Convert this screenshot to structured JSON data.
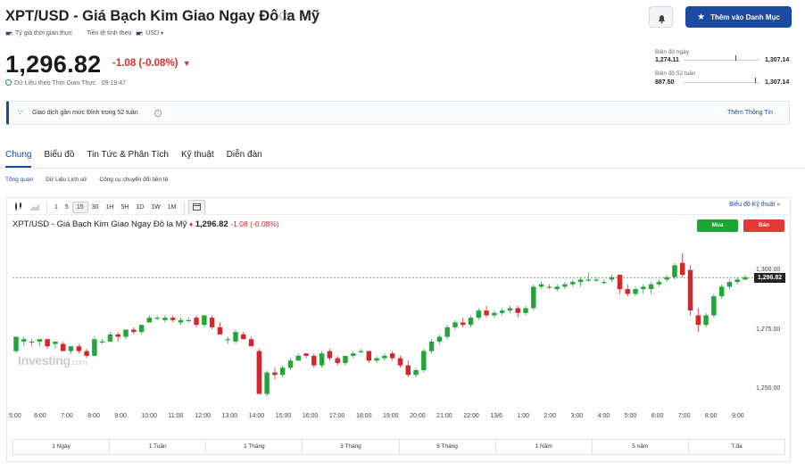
{
  "header": {
    "title": "XPT/USD - Giá Bạch Kim Giao Ngay Đô la Mỹ",
    "sub_rate_label": "Tỷ giá thời gian thực",
    "sub_currency_label": "Tiền tệ tính theo",
    "sub_currency_value": "USD",
    "watchlist_label": "Thêm vào Danh Mục"
  },
  "quote": {
    "price": "1,296.82",
    "change": "-1.08 (-0.08%)",
    "realtime": "Dữ Liệu theo Thời Gian Thực · 09:19:47"
  },
  "ranges": {
    "day_label": "Biên độ ngày",
    "day_low": "1,274.11",
    "day_high": "1,307.14",
    "week52_label": "Biên độ 52 tuần",
    "week52_low": "887.50",
    "week52_high": "1,307.14"
  },
  "banner": {
    "text": "Giao dịch gần mức Đỉnh trong 52 tuần",
    "link": "Thêm Thông Tin"
  },
  "tabs": [
    "Chung",
    "Biểu đồ",
    "Tin Tức & Phân Tích",
    "Kỹ thuật",
    "Diễn đàn"
  ],
  "subtabs": [
    "Tổng quan",
    "Dữ Liệu Lịch sử",
    "Công cụ chuyển đổi tiền tệ"
  ],
  "toolbar": {
    "intervals": [
      "1",
      "5",
      "15",
      "30",
      "1H",
      "5H",
      "1D",
      "1W",
      "1M"
    ],
    "selected": "15",
    "tech_link": "Biểu đồ Kỹ thuật"
  },
  "chart_legend": {
    "name": "XPT/USD - Giá Bạch Kim Giao Ngay Đô la Mỹ",
    "price": "1,296.82",
    "change": "-1.08 (-0.08%)",
    "buy": "Mua",
    "sell": "Bán"
  },
  "watermark": {
    "brand": "Investing",
    "suffix": ".com"
  },
  "chart_data": {
    "type": "candlestick",
    "ylim": [
      1243,
      1313
    ],
    "y_ticks": [
      "1,300.00",
      "1,275.00",
      "1,250.00"
    ],
    "y_tick_values": [
      1300,
      1275,
      1250
    ],
    "current_price_label": "1,296.82",
    "current_price": 1296.82,
    "x_labels": [
      "5:00",
      "6:00",
      "7:00",
      "8:00",
      "9:00",
      "10:00",
      "11:00",
      "12:00",
      "13:00",
      "14:00",
      "15:00",
      "16:00",
      "17:00",
      "18:00",
      "19:00",
      "20:00",
      "21:00",
      "22:00",
      "13/6",
      "1:00",
      "2:00",
      "3:00",
      "4:00",
      "5:00",
      "6:00",
      "7:00",
      "8:00",
      "9:00"
    ],
    "colors": {
      "up": "#21a637",
      "down": "#d7262b"
    },
    "candles": [
      [
        1266,
        1272,
        1265,
        1272
      ],
      [
        1270,
        1272,
        1268,
        1271
      ],
      [
        1270,
        1271,
        1268,
        1270
      ],
      [
        1270,
        1271,
        1268,
        1271
      ],
      [
        1271,
        1271,
        1267,
        1268
      ],
      [
        1269,
        1270,
        1267,
        1270
      ],
      [
        1269,
        1270,
        1266,
        1266
      ],
      [
        1266,
        1268,
        1265,
        1268
      ],
      [
        1268,
        1269,
        1265,
        1266
      ],
      [
        1266,
        1267,
        1263,
        1264
      ],
      [
        1264,
        1272,
        1264,
        1271
      ],
      [
        1270,
        1271,
        1269,
        1270
      ],
      [
        1270,
        1274,
        1270,
        1273
      ],
      [
        1273,
        1274,
        1270,
        1272
      ],
      [
        1272,
        1275,
        1271,
        1275
      ],
      [
        1275,
        1276,
        1273,
        1274
      ],
      [
        1274,
        1277,
        1273,
        1277
      ],
      [
        1278,
        1281,
        1278,
        1280
      ],
      [
        1280,
        1281,
        1279,
        1280
      ],
      [
        1279,
        1281,
        1278,
        1280
      ],
      [
        1280,
        1281,
        1278,
        1279
      ],
      [
        1278,
        1280,
        1277,
        1279
      ],
      [
        1279,
        1280,
        1278,
        1279
      ],
      [
        1280,
        1281,
        1276,
        1277
      ],
      [
        1277,
        1281,
        1276,
        1281
      ],
      [
        1280,
        1281,
        1275,
        1276
      ],
      [
        1276,
        1278,
        1273,
        1273
      ],
      [
        1271,
        1272,
        1269,
        1271
      ],
      [
        1270,
        1275,
        1269,
        1274
      ],
      [
        1273,
        1274,
        1271,
        1271
      ],
      [
        1271,
        1272,
        1268,
        1268
      ],
      [
        1266,
        1267,
        1248,
        1248
      ],
      [
        1248,
        1258,
        1247,
        1257
      ],
      [
        1257,
        1259,
        1254,
        1256
      ],
      [
        1256,
        1260,
        1255,
        1259
      ],
      [
        1259,
        1263,
        1258,
        1262
      ],
      [
        1262,
        1265,
        1262,
        1264
      ],
      [
        1265,
        1265,
        1263,
        1264
      ],
      [
        1264,
        1265,
        1259,
        1260
      ],
      [
        1260,
        1266,
        1259,
        1265
      ],
      [
        1266,
        1267,
        1262,
        1263
      ],
      [
        1263,
        1264,
        1260,
        1261
      ],
      [
        1261,
        1264,
        1260,
        1264
      ],
      [
        1264,
        1266,
        1263,
        1265
      ],
      [
        1266,
        1267,
        1265,
        1266
      ],
      [
        1266,
        1266,
        1261,
        1262
      ],
      [
        1262,
        1264,
        1261,
        1263
      ],
      [
        1263,
        1265,
        1262,
        1264
      ],
      [
        1265,
        1266,
        1262,
        1263
      ],
      [
        1263,
        1264,
        1259,
        1260
      ],
      [
        1260,
        1262,
        1255,
        1256
      ],
      [
        1256,
        1259,
        1255,
        1258
      ],
      [
        1258,
        1267,
        1257,
        1266
      ],
      [
        1266,
        1271,
        1265,
        1270
      ],
      [
        1270,
        1273,
        1269,
        1272
      ],
      [
        1272,
        1277,
        1271,
        1276
      ],
      [
        1276,
        1279,
        1275,
        1278
      ],
      [
        1278,
        1280,
        1276,
        1277
      ],
      [
        1277,
        1281,
        1276,
        1280
      ],
      [
        1280,
        1284,
        1279,
        1283
      ],
      [
        1283,
        1285,
        1280,
        1281
      ],
      [
        1281,
        1283,
        1280,
        1282
      ],
      [
        1282,
        1284,
        1281,
        1283
      ],
      [
        1283,
        1285,
        1282,
        1284
      ],
      [
        1284,
        1285,
        1280,
        1282
      ],
      [
        1282,
        1285,
        1281,
        1284
      ],
      [
        1284,
        1294,
        1283,
        1293
      ],
      [
        1293,
        1295,
        1292,
        1294
      ],
      [
        1293,
        1294,
        1292,
        1293
      ],
      [
        1292,
        1294,
        1291,
        1293
      ],
      [
        1293,
        1295,
        1292,
        1294
      ],
      [
        1294,
        1296,
        1293,
        1295
      ],
      [
        1295,
        1297,
        1293,
        1296
      ],
      [
        1296,
        1299,
        1295,
        1296
      ],
      [
        1296,
        1297,
        1295,
        1296
      ],
      [
        1295,
        1296,
        1294,
        1295
      ],
      [
        1296,
        1298,
        1295,
        1297
      ],
      [
        1298,
        1298,
        1290,
        1292
      ],
      [
        1292,
        1294,
        1289,
        1290
      ],
      [
        1290,
        1293,
        1289,
        1292
      ],
      [
        1292,
        1294,
        1290,
        1293
      ],
      [
        1292,
        1295,
        1290,
        1294
      ],
      [
        1294,
        1296,
        1293,
        1295
      ],
      [
        1296,
        1298,
        1295,
        1297
      ],
      [
        1297,
        1303,
        1296,
        1302
      ],
      [
        1303,
        1307,
        1297,
        1298
      ],
      [
        1300,
        1302,
        1281,
        1283
      ],
      [
        1281,
        1284,
        1274,
        1277
      ],
      [
        1277,
        1282,
        1276,
        1281
      ],
      [
        1281,
        1290,
        1280,
        1289
      ],
      [
        1289,
        1294,
        1288,
        1293
      ],
      [
        1293,
        1296,
        1292,
        1295
      ],
      [
        1295,
        1297,
        1294,
        1296
      ],
      [
        1296,
        1298,
        1296,
        1297
      ]
    ]
  },
  "periods": [
    "1 Ngày",
    "1 Tuần",
    "1 Tháng",
    "3 Tháng",
    "6 Tháng",
    "1 Năm",
    "5 năm",
    "T.đa"
  ]
}
